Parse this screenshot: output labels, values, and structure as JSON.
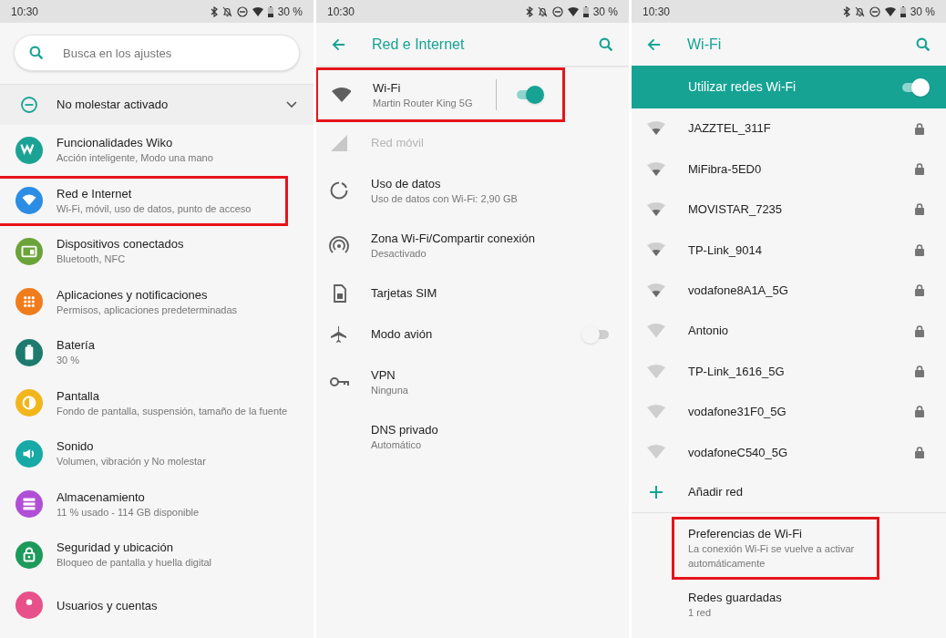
{
  "screens": [
    {
      "status_bar": {
        "time": "10:30",
        "battery": "30 %"
      },
      "search": {
        "placeholder": "Busca en los ajustes"
      },
      "dnd_banner": {
        "label": "No molestar activado",
        "expanded": false
      },
      "items": [
        {
          "title": "Funcionalidades Wiko",
          "subtitle": "Acción inteligente, Modo una mano",
          "color": "#1aa394",
          "highlighted": false
        },
        {
          "title": "Red e Internet",
          "subtitle": "Wi-Fi, móvil, uso de datos, punto de acceso",
          "color": "#2b8de3",
          "highlighted": true
        },
        {
          "title": "Dispositivos conectados",
          "subtitle": "Bluetooth, NFC",
          "color": "#6aa33a",
          "highlighted": false
        },
        {
          "title": "Aplicaciones y notificaciones",
          "subtitle": "Permisos, aplicaciones predeterminadas",
          "color": "#f07c1c",
          "highlighted": false
        },
        {
          "title": "Batería",
          "subtitle": "30 %",
          "color": "#1f7a6e",
          "highlighted": false
        },
        {
          "title": "Pantalla",
          "subtitle": "Fondo de pantalla, suspensión, tamaño de la fuente",
          "color": "#f2b61d",
          "highlighted": false
        },
        {
          "title": "Sonido",
          "subtitle": "Volumen, vibración y No molestar",
          "color": "#17a9a6",
          "highlighted": false
        },
        {
          "title": "Almacenamiento",
          "subtitle": "11 % usado - 114 GB disponible",
          "color": "#b04fd6",
          "highlighted": false
        },
        {
          "title": "Seguridad y ubicación",
          "subtitle": "Bloqueo de pantalla y huella digital",
          "color": "#1c9a5a",
          "highlighted": false
        },
        {
          "title": "Usuarios y cuentas",
          "color": "#e8508a",
          "highlighted": false
        }
      ]
    },
    {
      "status_bar": {
        "time": "10:30",
        "battery": "30 %"
      },
      "title": "Red e Internet",
      "items": [
        {
          "title": "Wi-Fi",
          "subtitle": "Martin Router King 5G",
          "kind": "toggle",
          "on": true,
          "divider": true,
          "disabled": false,
          "highlighted": true
        },
        {
          "title": "Red móvil",
          "kind": "plain",
          "disabled": true,
          "highlighted": false
        },
        {
          "title": "Uso de datos",
          "subtitle": "Uso de datos con Wi-Fi: 2,90 GB",
          "kind": "plain",
          "disabled": false,
          "highlighted": false
        },
        {
          "title": "Zona Wi-Fi/Compartir conexión",
          "subtitle": "Desactivado",
          "kind": "plain",
          "disabled": false,
          "highlighted": false
        },
        {
          "title": "Tarjetas SIM",
          "kind": "plain",
          "disabled": false,
          "highlighted": false
        },
        {
          "title": "Modo avión",
          "kind": "toggle",
          "on": false,
          "divider": false,
          "disabled": false,
          "highlighted": false
        },
        {
          "title": "VPN",
          "subtitle": "Ninguna",
          "kind": "plain",
          "disabled": false,
          "highlighted": false
        },
        {
          "title": "DNS privado",
          "subtitle": "Automático",
          "kind": "plain",
          "disabled": false,
          "highlighted": false
        }
      ]
    },
    {
      "status_bar": {
        "time": "10:30",
        "battery": "30 %"
      },
      "title": "Wi-Fi",
      "master_switch": {
        "label": "Utilizar redes Wi-Fi",
        "on": true
      },
      "networks": [
        {
          "name": "JAZZTEL_311F",
          "locked": true
        },
        {
          "name": "MiFibra-5ED0",
          "locked": true
        },
        {
          "name": "MOVISTAR_7235",
          "locked": true
        },
        {
          "name": "TP-Link_9014",
          "locked": true
        },
        {
          "name": "vodafone8A1A_5G",
          "locked": true
        },
        {
          "name": "Antonio",
          "locked": true
        },
        {
          "name": "TP-Link_1616_5G",
          "locked": true
        },
        {
          "name": "vodafone31F0_5G",
          "locked": true
        },
        {
          "name": "vodafoneC540_5G",
          "locked": true
        }
      ],
      "add_network": {
        "label": "Añadir red"
      },
      "entries": [
        {
          "title": "Preferencias de Wi-Fi",
          "subtitle": "La conexión Wi-Fi se vuelve a activar automáticamente",
          "highlighted": true
        },
        {
          "title": "Redes guardadas",
          "subtitle": "1 red",
          "highlighted": false
        }
      ]
    }
  ]
}
